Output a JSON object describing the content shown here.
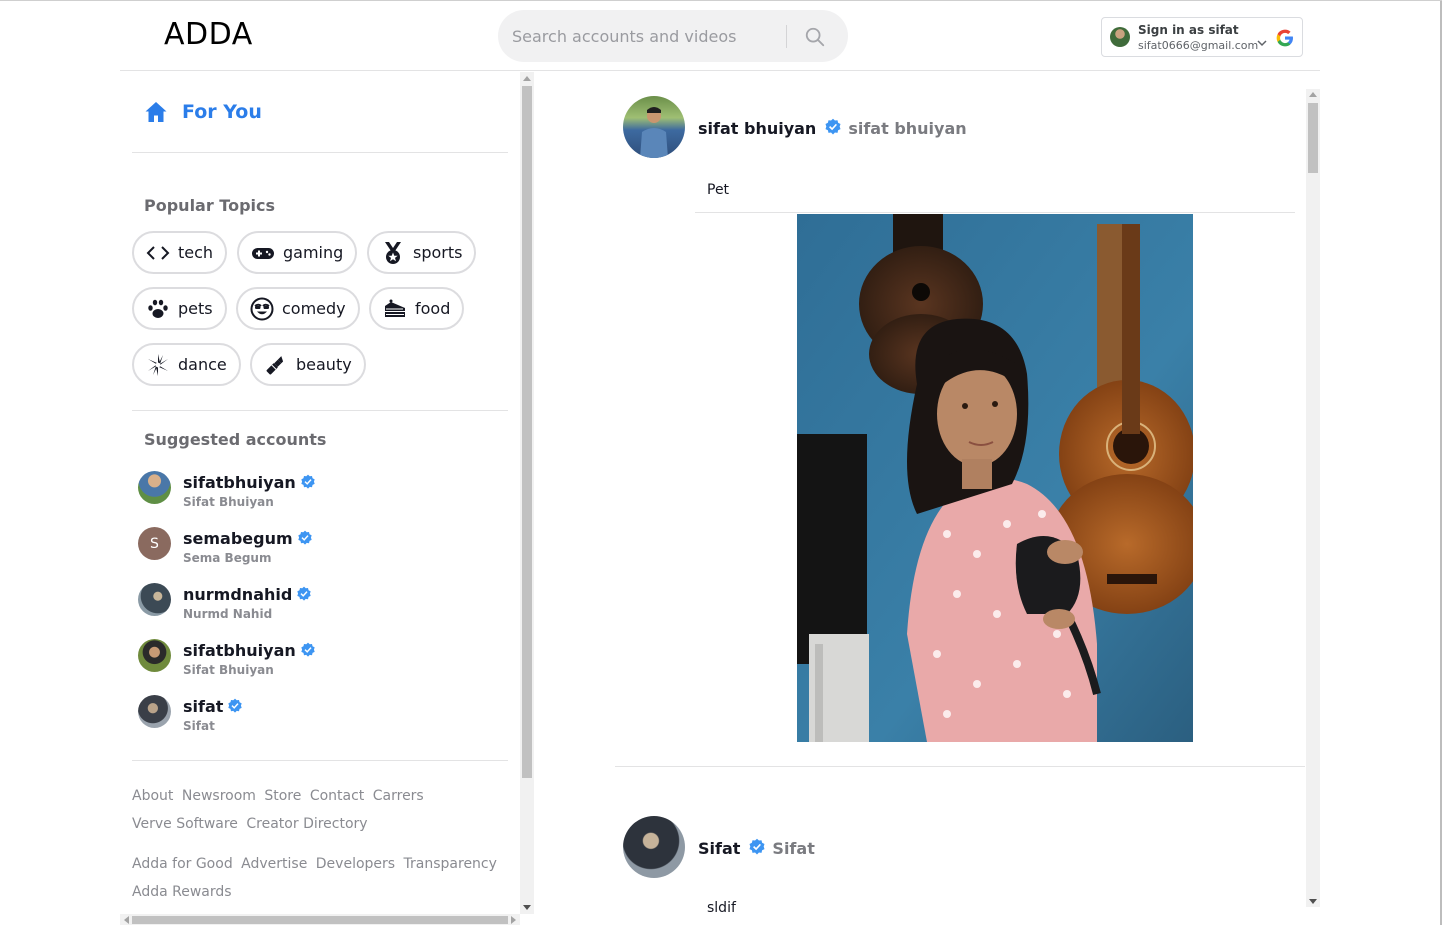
{
  "header": {
    "logo": "ADDA",
    "search_placeholder": "Search accounts and videos",
    "search_icon": "search-icon",
    "google_signin": {
      "title": "Sign in as sifat",
      "email": "sifat0666@gmail.com"
    }
  },
  "sidebar": {
    "for_you": "For You",
    "popular_topics_title": "Popular Topics",
    "topics": [
      {
        "label": "tech",
        "icon": "code-icon"
      },
      {
        "label": "gaming",
        "icon": "gamepad-icon"
      },
      {
        "label": "sports",
        "icon": "medal-icon"
      },
      {
        "label": "pets",
        "icon": "paw-icon"
      },
      {
        "label": "comedy",
        "icon": "laugh-icon"
      },
      {
        "label": "food",
        "icon": "cake-icon"
      },
      {
        "label": "dance",
        "icon": "spiral-icon"
      },
      {
        "label": "beauty",
        "icon": "lipstick-icon"
      }
    ],
    "suggested_title": "Suggested accounts",
    "accounts": [
      {
        "username": "sifatbhuiyan",
        "display_name": "Sifat Bhuiyan"
      },
      {
        "username": "semabegum",
        "display_name": "Sema Begum",
        "initial": "S"
      },
      {
        "username": "nurmdnahid",
        "display_name": "Nurmd Nahid"
      },
      {
        "username": "sifatbhuiyan",
        "display_name": "Sifat Bhuiyan"
      },
      {
        "username": "sifat",
        "display_name": "Sifat"
      }
    ],
    "footer_row1": [
      "About",
      "Newsroom",
      "Store",
      "Contact",
      "Carrers"
    ],
    "footer_row2": [
      "Verve Software",
      "Creator Directory"
    ],
    "footer_row3": [
      "Adda for Good",
      "Advertise",
      "Developers",
      "Transparency"
    ],
    "footer_row4": [
      "Adda Rewards"
    ]
  },
  "feed": {
    "posts": [
      {
        "name": "sifat bhuiyan",
        "nickname": "sifat bhuiyan",
        "caption": "Pet"
      },
      {
        "name": "Sifat",
        "nickname": "Sifat",
        "caption": "sldif"
      }
    ]
  },
  "colors": {
    "accent": "#2b7de9",
    "verified": "#3d95f2",
    "muted": "#8a8b91"
  }
}
